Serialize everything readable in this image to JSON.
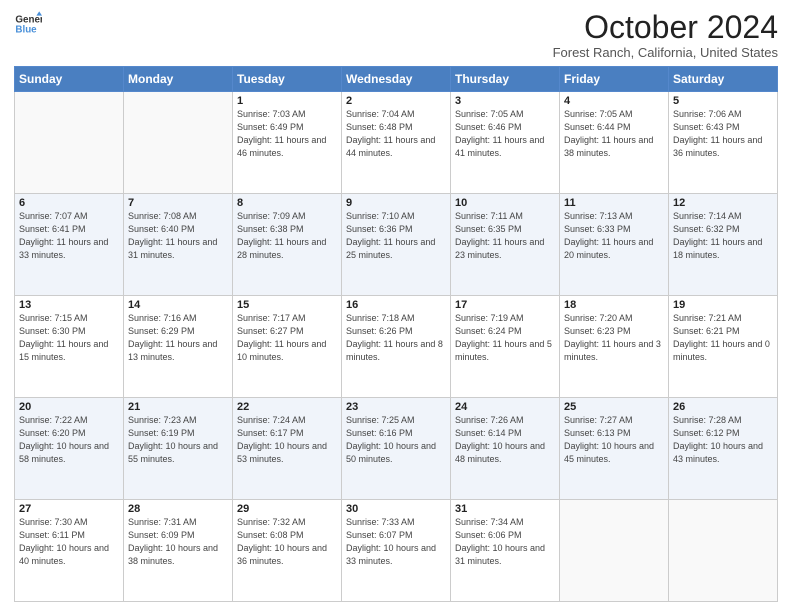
{
  "header": {
    "logo_line1": "General",
    "logo_line2": "Blue",
    "title": "October 2024",
    "subtitle": "Forest Ranch, California, United States"
  },
  "days_of_week": [
    "Sunday",
    "Monday",
    "Tuesday",
    "Wednesday",
    "Thursday",
    "Friday",
    "Saturday"
  ],
  "weeks": [
    [
      {
        "num": "",
        "detail": ""
      },
      {
        "num": "",
        "detail": ""
      },
      {
        "num": "1",
        "detail": "Sunrise: 7:03 AM\nSunset: 6:49 PM\nDaylight: 11 hours and 46 minutes."
      },
      {
        "num": "2",
        "detail": "Sunrise: 7:04 AM\nSunset: 6:48 PM\nDaylight: 11 hours and 44 minutes."
      },
      {
        "num": "3",
        "detail": "Sunrise: 7:05 AM\nSunset: 6:46 PM\nDaylight: 11 hours and 41 minutes."
      },
      {
        "num": "4",
        "detail": "Sunrise: 7:05 AM\nSunset: 6:44 PM\nDaylight: 11 hours and 38 minutes."
      },
      {
        "num": "5",
        "detail": "Sunrise: 7:06 AM\nSunset: 6:43 PM\nDaylight: 11 hours and 36 minutes."
      }
    ],
    [
      {
        "num": "6",
        "detail": "Sunrise: 7:07 AM\nSunset: 6:41 PM\nDaylight: 11 hours and 33 minutes."
      },
      {
        "num": "7",
        "detail": "Sunrise: 7:08 AM\nSunset: 6:40 PM\nDaylight: 11 hours and 31 minutes."
      },
      {
        "num": "8",
        "detail": "Sunrise: 7:09 AM\nSunset: 6:38 PM\nDaylight: 11 hours and 28 minutes."
      },
      {
        "num": "9",
        "detail": "Sunrise: 7:10 AM\nSunset: 6:36 PM\nDaylight: 11 hours and 25 minutes."
      },
      {
        "num": "10",
        "detail": "Sunrise: 7:11 AM\nSunset: 6:35 PM\nDaylight: 11 hours and 23 minutes."
      },
      {
        "num": "11",
        "detail": "Sunrise: 7:13 AM\nSunset: 6:33 PM\nDaylight: 11 hours and 20 minutes."
      },
      {
        "num": "12",
        "detail": "Sunrise: 7:14 AM\nSunset: 6:32 PM\nDaylight: 11 hours and 18 minutes."
      }
    ],
    [
      {
        "num": "13",
        "detail": "Sunrise: 7:15 AM\nSunset: 6:30 PM\nDaylight: 11 hours and 15 minutes."
      },
      {
        "num": "14",
        "detail": "Sunrise: 7:16 AM\nSunset: 6:29 PM\nDaylight: 11 hours and 13 minutes."
      },
      {
        "num": "15",
        "detail": "Sunrise: 7:17 AM\nSunset: 6:27 PM\nDaylight: 11 hours and 10 minutes."
      },
      {
        "num": "16",
        "detail": "Sunrise: 7:18 AM\nSunset: 6:26 PM\nDaylight: 11 hours and 8 minutes."
      },
      {
        "num": "17",
        "detail": "Sunrise: 7:19 AM\nSunset: 6:24 PM\nDaylight: 11 hours and 5 minutes."
      },
      {
        "num": "18",
        "detail": "Sunrise: 7:20 AM\nSunset: 6:23 PM\nDaylight: 11 hours and 3 minutes."
      },
      {
        "num": "19",
        "detail": "Sunrise: 7:21 AM\nSunset: 6:21 PM\nDaylight: 11 hours and 0 minutes."
      }
    ],
    [
      {
        "num": "20",
        "detail": "Sunrise: 7:22 AM\nSunset: 6:20 PM\nDaylight: 10 hours and 58 minutes."
      },
      {
        "num": "21",
        "detail": "Sunrise: 7:23 AM\nSunset: 6:19 PM\nDaylight: 10 hours and 55 minutes."
      },
      {
        "num": "22",
        "detail": "Sunrise: 7:24 AM\nSunset: 6:17 PM\nDaylight: 10 hours and 53 minutes."
      },
      {
        "num": "23",
        "detail": "Sunrise: 7:25 AM\nSunset: 6:16 PM\nDaylight: 10 hours and 50 minutes."
      },
      {
        "num": "24",
        "detail": "Sunrise: 7:26 AM\nSunset: 6:14 PM\nDaylight: 10 hours and 48 minutes."
      },
      {
        "num": "25",
        "detail": "Sunrise: 7:27 AM\nSunset: 6:13 PM\nDaylight: 10 hours and 45 minutes."
      },
      {
        "num": "26",
        "detail": "Sunrise: 7:28 AM\nSunset: 6:12 PM\nDaylight: 10 hours and 43 minutes."
      }
    ],
    [
      {
        "num": "27",
        "detail": "Sunrise: 7:30 AM\nSunset: 6:11 PM\nDaylight: 10 hours and 40 minutes."
      },
      {
        "num": "28",
        "detail": "Sunrise: 7:31 AM\nSunset: 6:09 PM\nDaylight: 10 hours and 38 minutes."
      },
      {
        "num": "29",
        "detail": "Sunrise: 7:32 AM\nSunset: 6:08 PM\nDaylight: 10 hours and 36 minutes."
      },
      {
        "num": "30",
        "detail": "Sunrise: 7:33 AM\nSunset: 6:07 PM\nDaylight: 10 hours and 33 minutes."
      },
      {
        "num": "31",
        "detail": "Sunrise: 7:34 AM\nSunset: 6:06 PM\nDaylight: 10 hours and 31 minutes."
      },
      {
        "num": "",
        "detail": ""
      },
      {
        "num": "",
        "detail": ""
      }
    ]
  ]
}
